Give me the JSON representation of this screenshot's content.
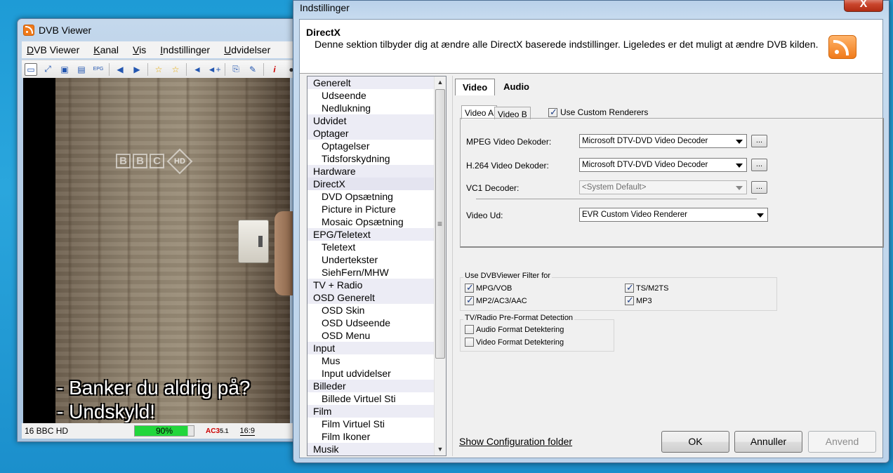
{
  "dvb": {
    "title": "DVB Viewer",
    "menu": [
      "DVB Viewer",
      "Kanal",
      "Vis",
      "Indstillinger",
      "Udvidelser"
    ],
    "logo": "BBC",
    "subtitle_line1": "- Banker du aldrig på?",
    "subtitle_line2": "- Undskyld!",
    "status": {
      "channel": "16 BBC HD",
      "signal_label": "90%",
      "signal_fraction": 0.9,
      "audio_badge": "AC3",
      "audio_channels": "5.1",
      "aspect": "16:9"
    }
  },
  "dialog": {
    "title": "Indstillinger",
    "close": "X",
    "header_title": "DirectX",
    "header_desc": "Denne sektion tilbyder dig at ændre alle DirectX baserede indstillinger. Ligeledes er det muligt at ændre DVB kilden.",
    "tree": [
      {
        "label": "Generelt",
        "cat": true
      },
      {
        "label": "Udseende",
        "cat": false
      },
      {
        "label": "Nedlukning",
        "cat": false
      },
      {
        "label": "Udvidet",
        "cat": true
      },
      {
        "label": "Optager",
        "cat": true
      },
      {
        "label": "Optagelser",
        "cat": false
      },
      {
        "label": "Tidsforskydning",
        "cat": false
      },
      {
        "label": "Hardware",
        "cat": true
      },
      {
        "label": "DirectX",
        "cat": true
      },
      {
        "label": "DVD Opsætning",
        "cat": false
      },
      {
        "label": "Picture in Picture",
        "cat": false
      },
      {
        "label": "Mosaic Opsætning",
        "cat": false
      },
      {
        "label": "EPG/Teletext",
        "cat": true
      },
      {
        "label": "Teletext",
        "cat": false
      },
      {
        "label": "Undertekster",
        "cat": false
      },
      {
        "label": "SiehFern/MHW",
        "cat": false
      },
      {
        "label": "TV + Radio",
        "cat": true
      },
      {
        "label": "OSD Generelt",
        "cat": true
      },
      {
        "label": "OSD Skin",
        "cat": false
      },
      {
        "label": "OSD Udseende",
        "cat": false
      },
      {
        "label": "OSD Menu",
        "cat": false
      },
      {
        "label": "Input",
        "cat": true
      },
      {
        "label": "Mus",
        "cat": false
      },
      {
        "label": "Input udvidelser",
        "cat": false
      },
      {
        "label": "Billeder",
        "cat": true
      },
      {
        "label": "Billede Virtuel Sti",
        "cat": false
      },
      {
        "label": "Film",
        "cat": true
      },
      {
        "label": "Film Virtuel Sti",
        "cat": false
      },
      {
        "label": "Film Ikoner",
        "cat": false
      },
      {
        "label": "Musik",
        "cat": true
      }
    ],
    "tabs": [
      "Video",
      "Audio"
    ],
    "subtabs": [
      "Video A",
      "Video B"
    ],
    "use_custom_renderers": "Use Custom Renderers",
    "mpeg_label": "MPEG Video Dekoder:",
    "mpeg_value": "Microsoft DTV-DVD Video Decoder",
    "h264_label": "H.264 Video Dekoder:",
    "h264_value": "Microsoft DTV-DVD Video Decoder",
    "vc1_label": "VC1 Decoder:",
    "vc1_value": "<System Default>",
    "videoud_label": "Video Ud:",
    "videoud_value": "EVR Custom Video Renderer",
    "ellipsis": "...",
    "filter_group": "Use DVBViewer Filter for",
    "filters": [
      "MPG/VOB",
      "TS/M2TS",
      "MP2/AC3/AAC",
      "MP3"
    ],
    "preformat_group": "TV/Radio Pre-Format Detection",
    "preformat": [
      "Audio Format Detektering",
      "Video Format Detektering"
    ],
    "config_link": "Show Configuration folder",
    "ok": "OK",
    "cancel": "Annuller",
    "apply": "Anvend"
  }
}
